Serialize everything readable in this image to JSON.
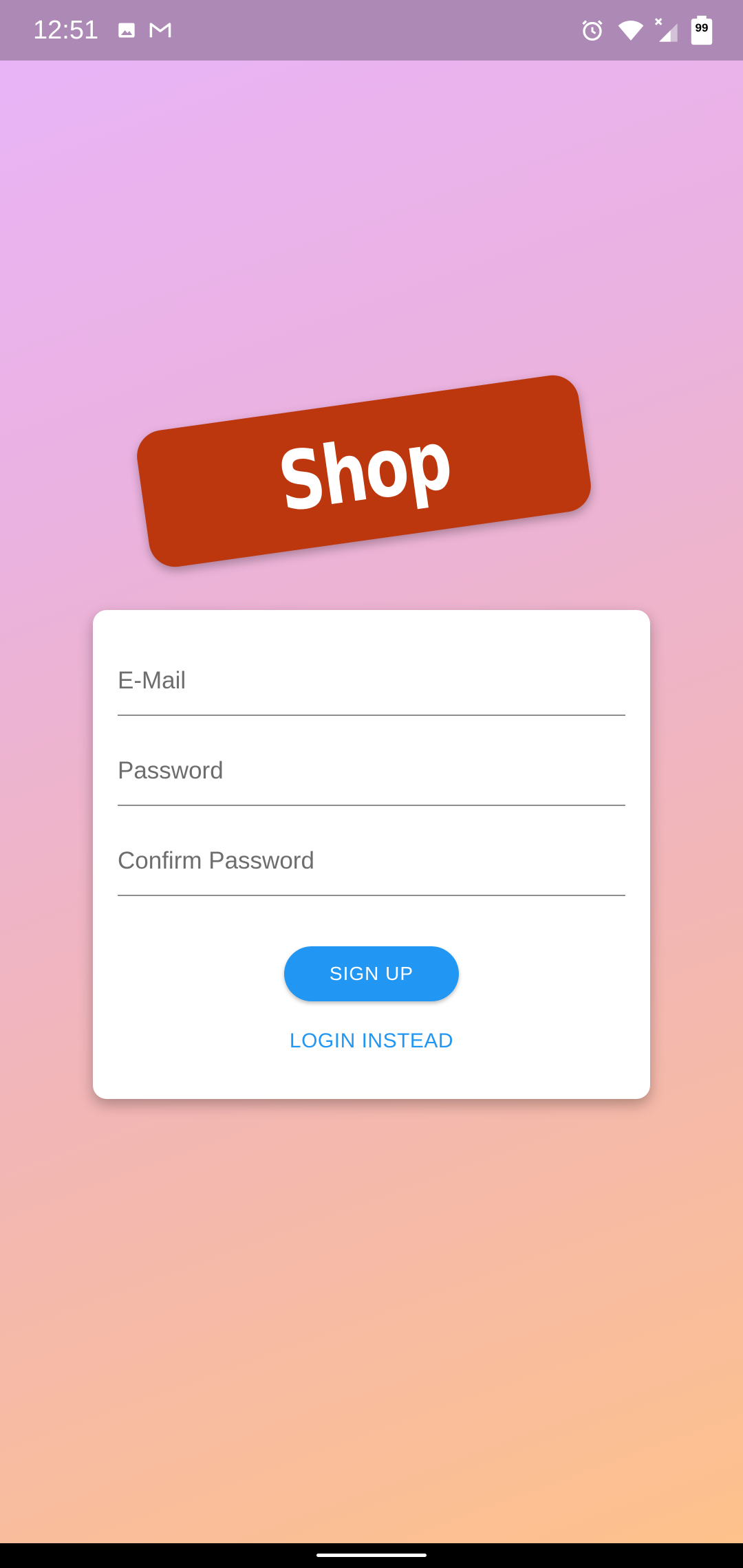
{
  "status_bar": {
    "time": "12:51",
    "battery_level": "99",
    "left_icons": [
      "image-icon",
      "gmail-icon"
    ],
    "right_icons": [
      "alarm-icon",
      "wifi-icon",
      "signal-icon",
      "battery-icon"
    ]
  },
  "logo": {
    "text": "Shop",
    "background_color": "#bd370e"
  },
  "form": {
    "email": {
      "placeholder": "E-Mail",
      "value": ""
    },
    "password": {
      "placeholder": "Password",
      "value": ""
    },
    "confirm_password": {
      "placeholder": "Confirm Password",
      "value": ""
    },
    "signup_label": "SIGN UP",
    "login_instead_label": "LOGIN INSTEAD"
  },
  "colors": {
    "accent": "#2196f3",
    "status_bar": "#ad8ab5",
    "gradient_start": "#e9b4fa",
    "gradient_end": "#fec28a"
  }
}
